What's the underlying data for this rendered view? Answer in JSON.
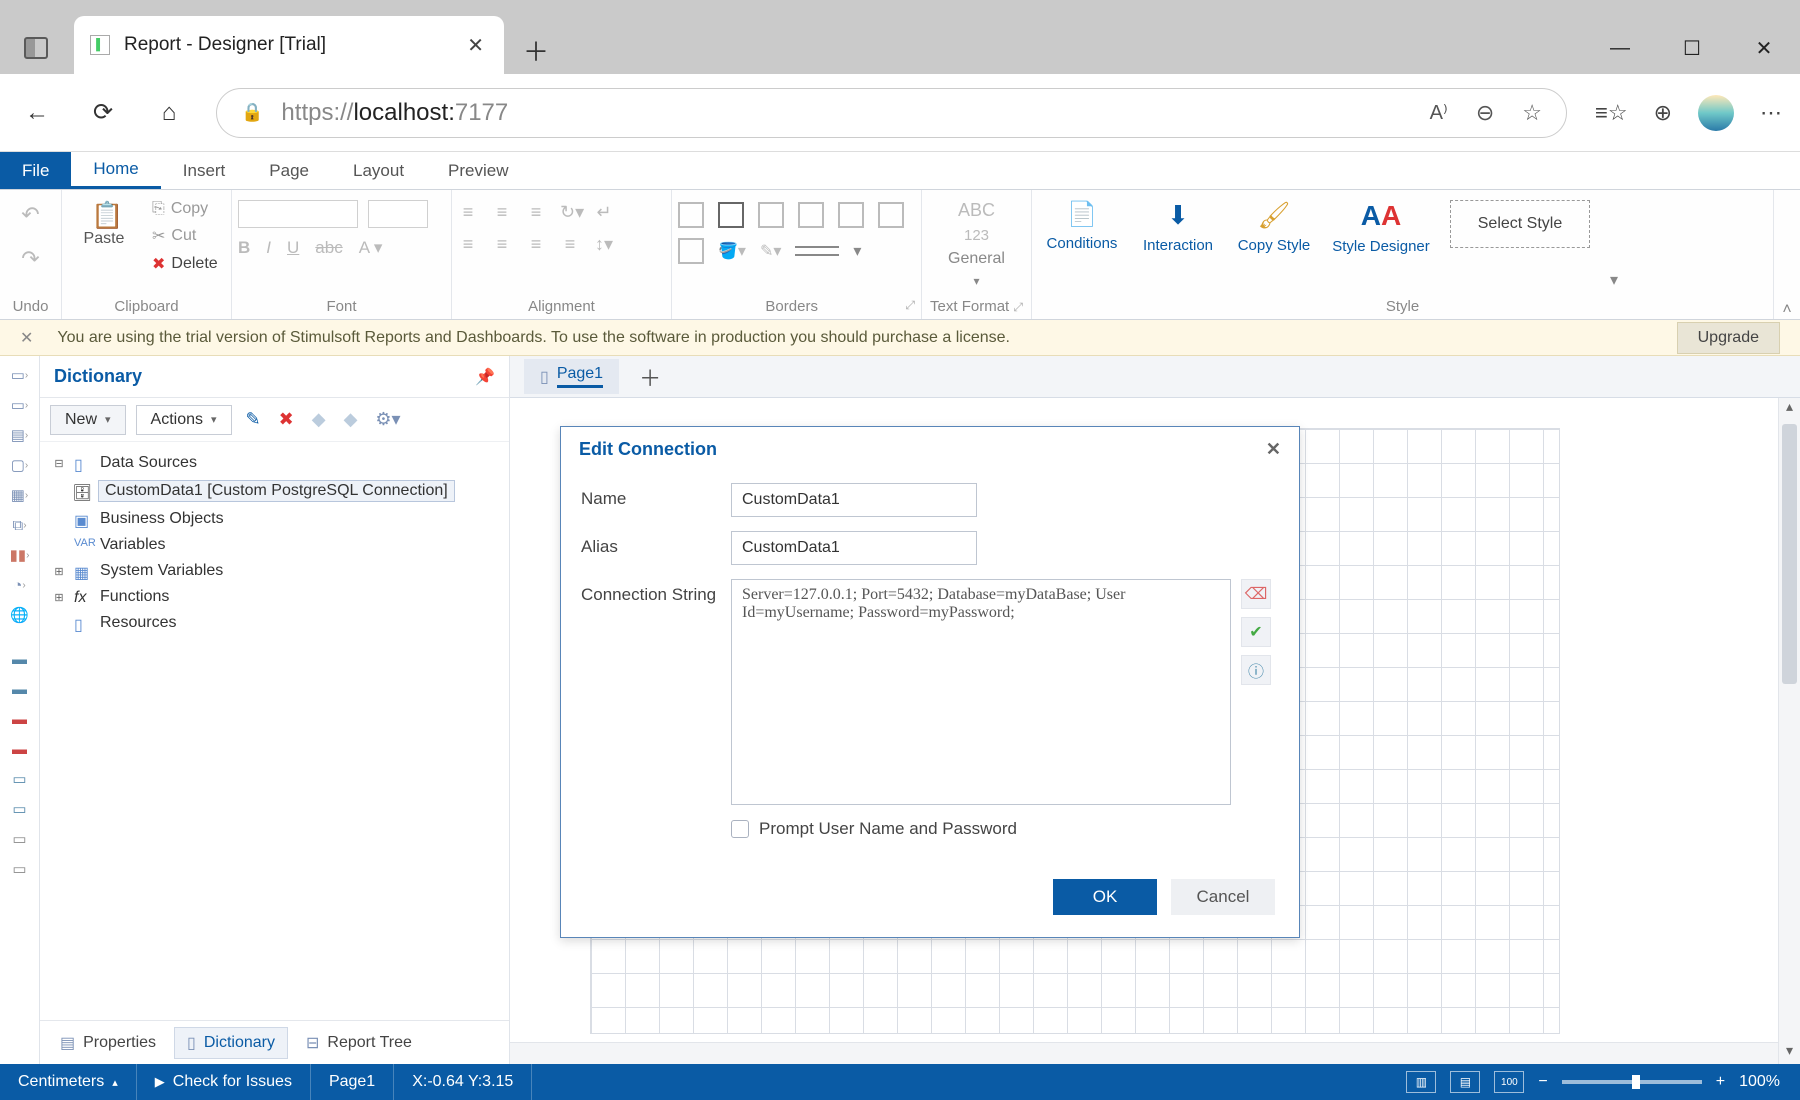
{
  "browser": {
    "tab_title": "Report - Designer [Trial]",
    "url_prefix": "https://",
    "url_host": "localhost:",
    "url_port": "7177"
  },
  "ribbon": {
    "tabs": {
      "file": "File",
      "home": "Home",
      "insert": "Insert",
      "page": "Page",
      "layout": "Layout",
      "preview": "Preview"
    },
    "paste": "Paste",
    "copy": "Copy",
    "cut": "Cut",
    "delete": "Delete",
    "abc": "ABC",
    "n123": "123",
    "general": "General",
    "conditions": "Conditions",
    "interaction": "Interaction",
    "copy_style": "Copy Style",
    "style_designer": "Style Designer",
    "select_style": "Select Style",
    "g_undo": "Undo",
    "g_clipboard": "Clipboard",
    "g_font": "Font",
    "g_align": "Alignment",
    "g_borders": "Borders",
    "g_tf": "Text Format",
    "g_style": "Style"
  },
  "trial": {
    "text": "You are using the trial version of Stimulsoft Reports and Dashboards. To use the software in production you should purchase a license.",
    "upgrade": "Upgrade"
  },
  "dict": {
    "title": "Dictionary",
    "new": "New",
    "actions": "Actions",
    "ds": "Data Sources",
    "custom": "CustomData1 [Custom PostgreSQL Connection]",
    "bo": "Business Objects",
    "vars": "Variables",
    "sys": "System Variables",
    "fn": "Functions",
    "res": "Resources",
    "tab_props": "Properties",
    "tab_dict": "Dictionary",
    "tab_tree": "Report Tree"
  },
  "page_tab": "Page1",
  "dialog": {
    "title": "Edit Connection",
    "name_lbl": "Name",
    "name_val": "CustomData1",
    "alias_lbl": "Alias",
    "alias_val": "CustomData1",
    "cs_lbl": "Connection String",
    "cs_val": "Server=127.0.0.1; Port=5432; Database=myDataBase; User Id=myUsername; Password=myPassword;",
    "prompt": "Prompt User Name and Password",
    "ok": "OK",
    "cancel": "Cancel"
  },
  "status": {
    "units": "Centimeters",
    "check": "Check for Issues",
    "page": "Page1",
    "coords": "X:-0.64 Y:3.15",
    "zoom": "100%"
  }
}
